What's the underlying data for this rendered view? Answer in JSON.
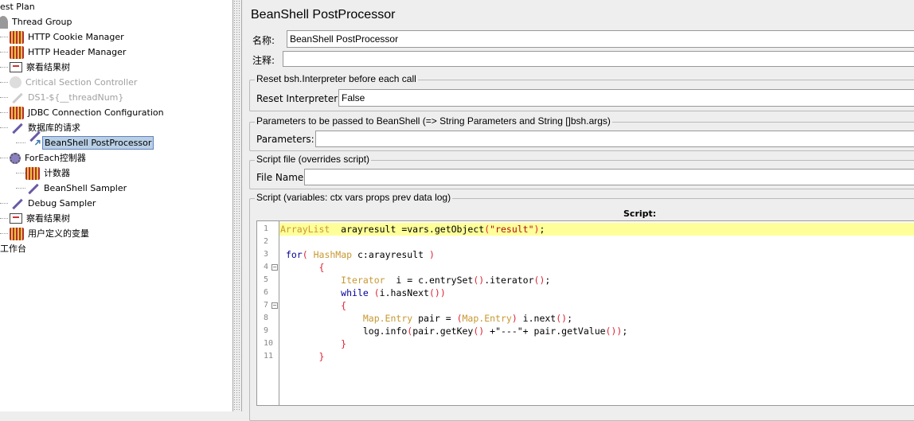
{
  "tree": {
    "items": [
      {
        "label": "est Plan",
        "icon": "test-plan-icon",
        "kind": "",
        "indent": 0
      },
      {
        "label": "Thread Group",
        "icon": "thread-group-icon",
        "kind": "tg",
        "indent": 0
      },
      {
        "label": "HTTP Cookie Manager",
        "icon": "config-element-icon",
        "kind": "cfg",
        "indent": 1
      },
      {
        "label": "HTTP Header Manager",
        "icon": "config-element-icon",
        "kind": "cfg",
        "indent": 1
      },
      {
        "label": "察看结果树",
        "icon": "listener-icon",
        "kind": "lst",
        "indent": 1
      },
      {
        "label": "Critical Section Controller",
        "icon": "controller-icon",
        "kind": "ctl",
        "indent": 1,
        "disabled": true
      },
      {
        "label": "DS1-${__threadNum}",
        "icon": "sampler-icon",
        "kind": "smp dis",
        "indent": 1,
        "disabled": true
      },
      {
        "label": "JDBC Connection Configuration",
        "icon": "config-element-icon",
        "kind": "cfg",
        "indent": 1
      },
      {
        "label": "数据库的请求",
        "icon": "sampler-icon",
        "kind": "smp",
        "indent": 1
      },
      {
        "label": "BeanShell PostProcessor",
        "icon": "post-processor-icon",
        "kind": "smp pp",
        "indent": 2,
        "selected": true
      },
      {
        "label": "ForEach控制器",
        "icon": "foreach-controller-icon",
        "kind": "fe",
        "indent": 1
      },
      {
        "label": "计数器",
        "icon": "config-element-icon",
        "kind": "cfg",
        "indent": 2
      },
      {
        "label": "BeanShell Sampler",
        "icon": "sampler-icon",
        "kind": "smp",
        "indent": 2
      },
      {
        "label": "Debug Sampler",
        "icon": "sampler-icon",
        "kind": "smp",
        "indent": 1
      },
      {
        "label": "察看结果树",
        "icon": "listener-icon",
        "kind": "lst",
        "indent": 1
      },
      {
        "label": "用户定义的变量",
        "icon": "config-element-icon",
        "kind": "cfg",
        "indent": 1
      },
      {
        "label": "工作台",
        "icon": "workbench-icon",
        "kind": "",
        "indent": 0
      }
    ]
  },
  "panel": {
    "title": "BeanShell PostProcessor",
    "name_label": "名称:",
    "name_value": "BeanShell PostProcessor",
    "comment_label": "注释:",
    "comment_value": "",
    "reset_group": "Reset bsh.Interpreter before each call",
    "reset_label": "Reset Interpreter:",
    "reset_value": "False",
    "params_group": "Parameters to be passed to BeanShell (=> String Parameters and String []bsh.args)",
    "params_label": "Parameters:",
    "params_value": "",
    "file_group": "Script file (overrides script)",
    "file_label": "File Name:",
    "file_value": "",
    "script_group": "Script (variables: ctx vars props prev data log)",
    "script_label": "Script:"
  },
  "script": {
    "highlight_line": 1,
    "fold_lines": [
      4,
      7
    ],
    "lines": [
      [
        [
          "ty",
          "ArrayList"
        ],
        [
          "pl",
          "  arayresult =vars.getObject"
        ],
        [
          "br",
          "("
        ],
        [
          "st",
          "\"result\""
        ],
        [
          "br",
          ")"
        ],
        [
          "pl",
          ";"
        ]
      ],
      [],
      [
        [
          "pl",
          " "
        ],
        [
          "kw",
          "for"
        ],
        [
          "br",
          "("
        ],
        [
          "pl",
          " "
        ],
        [
          "ty",
          "HashMap"
        ],
        [
          "pl",
          " c:arayresult "
        ],
        [
          "br",
          ")"
        ]
      ],
      [
        [
          "pl",
          "       "
        ],
        [
          "br",
          "{"
        ]
      ],
      [
        [
          "pl",
          "           "
        ],
        [
          "ty",
          "Iterator"
        ],
        [
          "pl",
          "  i = c.entrySet"
        ],
        [
          "br",
          "()"
        ],
        [
          "pl",
          ".iterator"
        ],
        [
          "br",
          "()"
        ],
        [
          "pl",
          ";"
        ]
      ],
      [
        [
          "pl",
          "           "
        ],
        [
          "kw",
          "while"
        ],
        [
          "pl",
          " "
        ],
        [
          "br",
          "("
        ],
        [
          "pl",
          "i.hasNext"
        ],
        [
          "br",
          "())"
        ]
      ],
      [
        [
          "pl",
          "           "
        ],
        [
          "br",
          "{"
        ]
      ],
      [
        [
          "pl",
          "               "
        ],
        [
          "ty",
          "Map.Entry"
        ],
        [
          "pl",
          " pair = "
        ],
        [
          "br",
          "("
        ],
        [
          "ty",
          "Map.Entry"
        ],
        [
          "br",
          ")"
        ],
        [
          "pl",
          " i.next"
        ],
        [
          "br",
          "()"
        ],
        [
          "pl",
          ";"
        ]
      ],
      [
        [
          "pl",
          "               log.info"
        ],
        [
          "br",
          "("
        ],
        [
          "pl",
          "pair.getKey"
        ],
        [
          "br",
          "()"
        ],
        [
          "pl",
          " +\"---\"+ pair.getValue"
        ],
        [
          "br",
          "())"
        ],
        [
          "pl",
          ";"
        ]
      ],
      [
        [
          "pl",
          "           "
        ],
        [
          "br",
          "}"
        ]
      ],
      [
        [
          "pl",
          "       "
        ],
        [
          "br",
          "}"
        ]
      ]
    ]
  }
}
